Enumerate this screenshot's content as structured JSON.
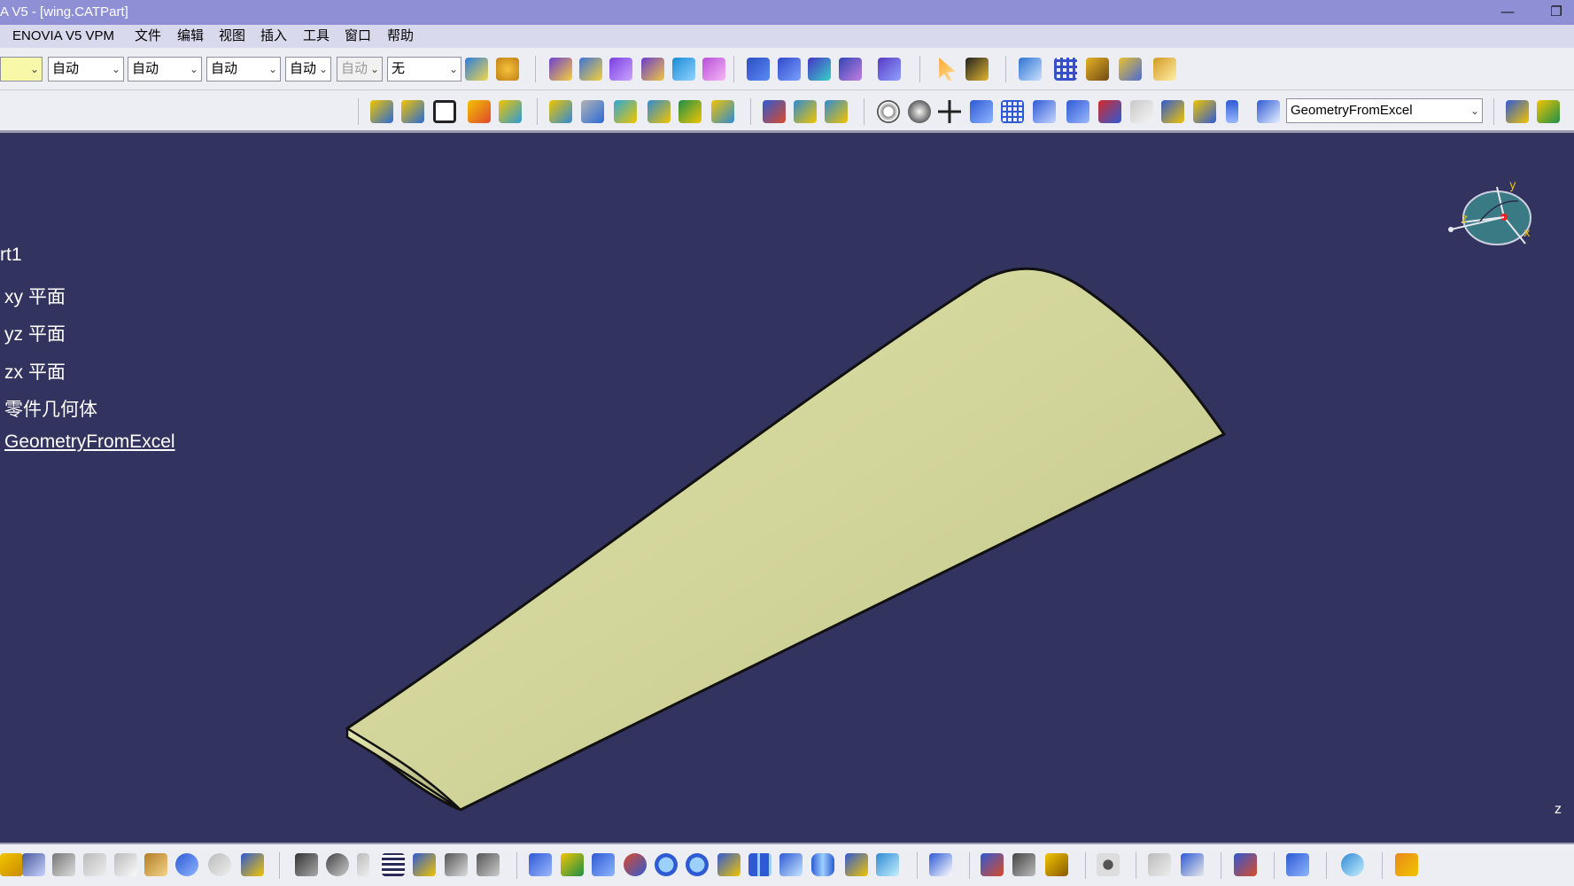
{
  "window": {
    "title": "A V5 - [wing.CATPart]",
    "minimize": "—",
    "restore": "❐"
  },
  "menu": [
    "ENOVIA V5 VPM",
    "文件",
    "编辑",
    "视图",
    "插入",
    "工具",
    "窗口",
    "帮助"
  ],
  "toolbar1": {
    "combos": [
      "",
      "自动",
      "自动",
      "自动",
      "自动",
      "自动",
      "无"
    ]
  },
  "toolbar2": {
    "body_select": "GeometryFromExcel"
  },
  "tree": {
    "root": "rt1",
    "items": [
      "xy 平面",
      "yz 平面",
      "zx 平面",
      "零件几何体",
      "GeometryFromExcel"
    ]
  },
  "compass": {
    "x": "x",
    "y": "y",
    "z": "z"
  },
  "corner_axis_label": "z",
  "icon_names": [
    "surface-tool-icon",
    "sketch-icon",
    "extrude-icon",
    "sweep-icon",
    "loft-icon",
    "select-arrow-icon",
    "fit-all-icon",
    "pan-icon",
    "rotate-icon",
    "zoom-in-icon",
    "zoom-out-icon",
    "normal-view-icon",
    "save-icon",
    "print-icon",
    "undo-icon",
    "redo-icon",
    "formula-icon",
    "camera-icon"
  ],
  "colors": {
    "viewport_bg": "#33335f",
    "part_surface": "#d2d59a",
    "titlebar": "#8f8fd6",
    "toolbar": "#eceef3"
  }
}
